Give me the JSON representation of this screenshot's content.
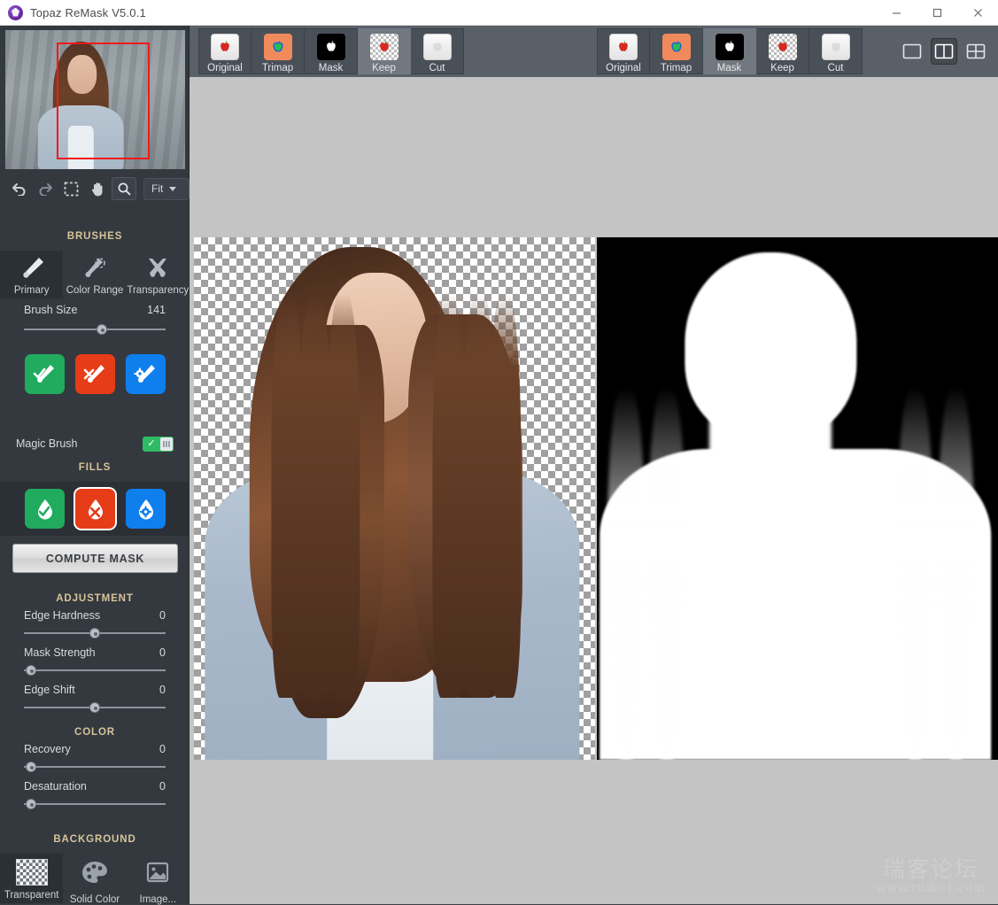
{
  "window": {
    "title": "Topaz ReMask V5.0.1",
    "app_icon": "topaz-logo-icon",
    "controls": {
      "minimize": "minimize-icon",
      "maximize": "maximize-icon",
      "close": "close-icon"
    }
  },
  "navigator": {
    "label": "navigator-thumbnail",
    "viewport_rect": "red-viewport-rectangle"
  },
  "tools": {
    "undo": "undo-icon",
    "redo": "redo-icon",
    "marquee": "marquee-select-icon",
    "hand": "hand-pan-icon",
    "zoom": "zoom-search-icon",
    "zoom_level": "Fit"
  },
  "brushes": {
    "title": "BRUSHES",
    "items": [
      {
        "label": "Primary",
        "icon": "brush-icon",
        "selected": true
      },
      {
        "label": "Color Range",
        "icon": "color-range-brush-icon",
        "selected": false
      },
      {
        "label": "Transparency",
        "icon": "transparency-brush-icon",
        "selected": false
      }
    ],
    "brush_size": {
      "label": "Brush Size",
      "value": "141",
      "position_pct": 50
    },
    "mode_buttons": [
      {
        "name": "keep-brush",
        "color": "#21ab5f",
        "glyph": "check",
        "selected": false
      },
      {
        "name": "cut-brush",
        "color": "#e63c18",
        "glyph": "cross",
        "selected": false
      },
      {
        "name": "compute-brush",
        "color": "#0f7fee",
        "glyph": "gear",
        "selected": false
      }
    ],
    "magic_brush": {
      "label": "Magic Brush",
      "enabled": true
    }
  },
  "fills": {
    "title": "FILLS",
    "buttons": [
      {
        "name": "keep-fill",
        "color": "#21ab5f",
        "glyph": "check",
        "selected": false
      },
      {
        "name": "cut-fill",
        "color": "#e63c18",
        "glyph": "cross",
        "selected": true
      },
      {
        "name": "compute-fill",
        "color": "#0f7fee",
        "glyph": "gear",
        "selected": false
      }
    ]
  },
  "compute_mask_button": "COMPUTE MASK",
  "adjustment": {
    "title": "ADJUSTMENT",
    "sliders": [
      {
        "label": "Edge Hardness",
        "value": "0",
        "position_pct": 50
      },
      {
        "label": "Mask Strength",
        "value": "0",
        "position_pct": 5
      },
      {
        "label": "Edge Shift",
        "value": "0",
        "position_pct": 50
      }
    ]
  },
  "color": {
    "title": "COLOR",
    "sliders": [
      {
        "label": "Recovery",
        "value": "0",
        "position_pct": 5
      },
      {
        "label": "Desaturation",
        "value": "0",
        "position_pct": 5
      }
    ]
  },
  "background": {
    "title": "BACKGROUND",
    "items": [
      {
        "label": "Transparent",
        "icon": "checkerboard-icon",
        "selected": true
      },
      {
        "label": "Solid Color",
        "icon": "palette-icon",
        "selected": false
      },
      {
        "label": "Image...",
        "icon": "image-icon",
        "selected": false
      }
    ]
  },
  "toolbar": {
    "left_group": [
      {
        "label": "Original",
        "icon": "apple-original-icon",
        "selected": false
      },
      {
        "label": "Trimap",
        "icon": "apple-trimap-icon",
        "selected": false
      },
      {
        "label": "Mask",
        "icon": "apple-mask-icon",
        "selected": false
      },
      {
        "label": "Keep",
        "icon": "apple-keep-icon",
        "selected": true
      },
      {
        "label": "Cut",
        "icon": "apple-cut-icon",
        "selected": false
      }
    ],
    "right_group": [
      {
        "label": "Original",
        "icon": "apple-original-icon",
        "selected": false
      },
      {
        "label": "Trimap",
        "icon": "apple-trimap-icon",
        "selected": false
      },
      {
        "label": "Mask",
        "icon": "apple-mask-icon",
        "selected": true
      },
      {
        "label": "Keep",
        "icon": "apple-keep-icon",
        "selected": false
      },
      {
        "label": "Cut",
        "icon": "apple-cut-icon",
        "selected": false
      }
    ],
    "view_modes": [
      {
        "name": "single-view",
        "icon": "single-pane-icon",
        "selected": false
      },
      {
        "name": "split-view",
        "icon": "split-pane-icon",
        "selected": true
      },
      {
        "name": "quad-view",
        "icon": "quad-pane-icon",
        "selected": false
      }
    ]
  },
  "canvas": {
    "left_pane": "cutout-preview-transparent-background",
    "right_pane": "mask-preview-black-white"
  },
  "watermark": {
    "cn": "瑞客论坛",
    "url": "www.ruike1.com"
  }
}
